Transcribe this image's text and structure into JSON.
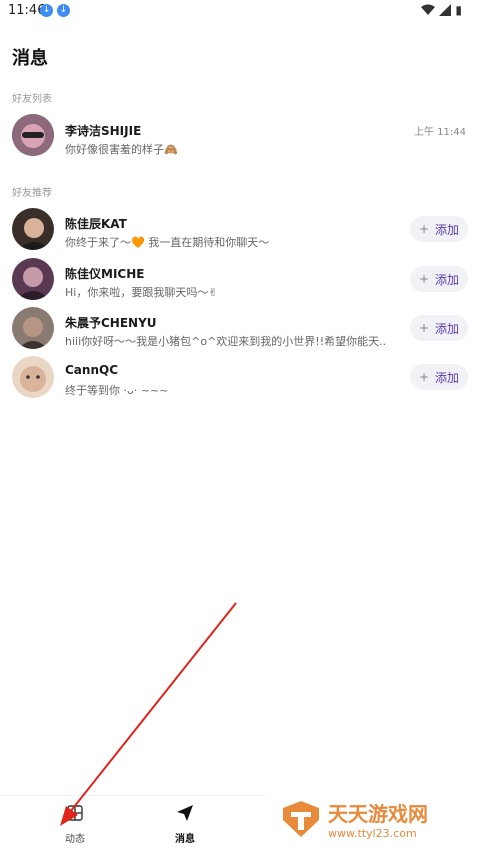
{
  "status": {
    "time": "11:46",
    "battery_glyph": "▮"
  },
  "header": {
    "title": "消息"
  },
  "sections": {
    "friends": "好友列表",
    "recommended": "好友推荐"
  },
  "friends": [
    {
      "name": "李诗洁SHIJIE",
      "message": "你好像很害羞的样子🙈",
      "time": "上午 11:44"
    }
  ],
  "recommended": [
    {
      "name": "陈佳辰KAT",
      "message": "你终于来了～🧡 我一直在期待和你聊天～",
      "action": "添加"
    },
    {
      "name": "陈佳仪MICHE",
      "message": "Hi，你来啦，要跟我聊天吗～✌",
      "action": "添加"
    },
    {
      "name": "朱晨予CHENYU",
      "message": "hiii你好呀～～我是小猪包^o^欢迎来到我的小世界!!希望你能天...",
      "action": "添加"
    },
    {
      "name": "CannQC",
      "message": "终于等到你 ·ᴗ· ~~~",
      "action": "添加"
    }
  ],
  "tabs": [
    {
      "label": "动态"
    },
    {
      "label": "消息"
    }
  ],
  "watermark": {
    "title": "天天游戏网",
    "url": "www.ttyl23.com"
  },
  "colors": {
    "accent": "#5b3bb0",
    "annotation_arrow": "#e0241b",
    "watermark": "#e88a3c"
  }
}
